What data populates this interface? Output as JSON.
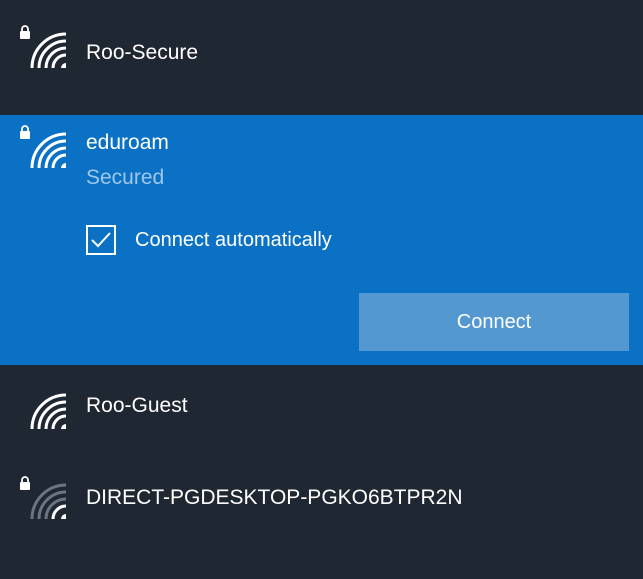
{
  "theme": {
    "background": "#1f2733",
    "selected_background": "#0b71c4",
    "button_background": "#5498d1",
    "secondary_text": "#9fc7ea"
  },
  "networks": [
    {
      "name": "Roo-Secure",
      "secured": true,
      "icon": "wifi-lock-icon"
    },
    {
      "name": "eduroam",
      "secured": true,
      "icon": "wifi-lock-icon",
      "status": "Secured",
      "selected": true,
      "auto_connect_label": "Connect automatically",
      "auto_connect_checked": true,
      "connect_label": "Connect"
    },
    {
      "name": "Roo-Guest",
      "secured": false,
      "icon": "wifi-icon"
    },
    {
      "name": "DIRECT-PGDESKTOP-PGKO6BTPR2N",
      "secured": true,
      "icon": "wifi-lock-icon"
    }
  ]
}
